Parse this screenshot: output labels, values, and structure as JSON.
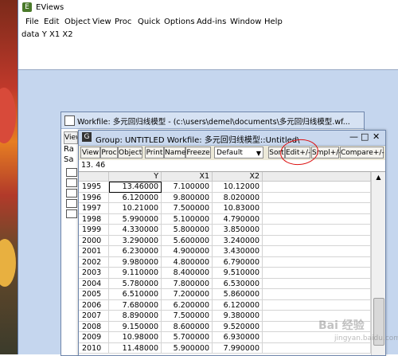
{
  "app": {
    "title": "EViews"
  },
  "menu": [
    "File",
    "Edit",
    "Object",
    "View",
    "Proc",
    "Quick",
    "Options",
    "Add-ins",
    "Window",
    "Help"
  ],
  "command": {
    "text": "data  Y X1 X2"
  },
  "workfile": {
    "title": "Workfile: 多元回归线模型 - (c:\\users\\demel\\documents\\多元回归线模型.wf...",
    "side_labels": [
      "Ra",
      "Sa"
    ],
    "button_label": "View"
  },
  "group": {
    "title": "Group: UNTITLED  Workfile: 多元回归线模型::Untitled\\",
    "controls": {
      "minimize": "—",
      "maximize": "□",
      "close": "✕"
    },
    "toolbar": [
      "View",
      "Proc",
      "Object",
      "Print",
      "Name",
      "Freeze"
    ],
    "display_select": "Default",
    "toolbar_right": [
      "Sort",
      "Edit+/-",
      "Smpl+/-",
      "Compare+/-"
    ],
    "cell_edit_value": "13. 46",
    "columns": [
      "",
      "Y",
      "X1",
      "X2"
    ],
    "rows": [
      {
        "obs": "1995",
        "y": "13.46000",
        "x1": "7.100000",
        "x2": "10.12000"
      },
      {
        "obs": "1996",
        "y": "6.120000",
        "x1": "9.800000",
        "x2": "8.020000"
      },
      {
        "obs": "1997",
        "y": "10.21000",
        "x1": "7.500000",
        "x2": "10.83000"
      },
      {
        "obs": "1998",
        "y": "5.990000",
        "x1": "5.100000",
        "x2": "4.790000"
      },
      {
        "obs": "1999",
        "y": "4.330000",
        "x1": "5.800000",
        "x2": "3.850000"
      },
      {
        "obs": "2000",
        "y": "3.290000",
        "x1": "5.600000",
        "x2": "3.240000"
      },
      {
        "obs": "2001",
        "y": "6.230000",
        "x1": "4.900000",
        "x2": "3.430000"
      },
      {
        "obs": "2002",
        "y": "9.980000",
        "x1": "4.800000",
        "x2": "6.790000"
      },
      {
        "obs": "2003",
        "y": "9.110000",
        "x1": "8.400000",
        "x2": "9.510000"
      },
      {
        "obs": "2004",
        "y": "5.780000",
        "x1": "7.800000",
        "x2": "6.530000"
      },
      {
        "obs": "2005",
        "y": "6.510000",
        "x1": "7.200000",
        "x2": "5.860000"
      },
      {
        "obs": "2006",
        "y": "7.680000",
        "x1": "6.200000",
        "x2": "6.120000"
      },
      {
        "obs": "2007",
        "y": "8.890000",
        "x1": "7.500000",
        "x2": "9.380000"
      },
      {
        "obs": "2008",
        "y": "9.150000",
        "x1": "8.600000",
        "x2": "9.520000"
      },
      {
        "obs": "2009",
        "y": "10.98000",
        "x1": "5.700000",
        "x2": "6.930000"
      },
      {
        "obs": "2010",
        "y": "11.48000",
        "x1": "5.900000",
        "x2": "7.990000"
      }
    ]
  },
  "watermark": {
    "main": "Bai 经验",
    "sub": "jingyan.baidu.com"
  }
}
